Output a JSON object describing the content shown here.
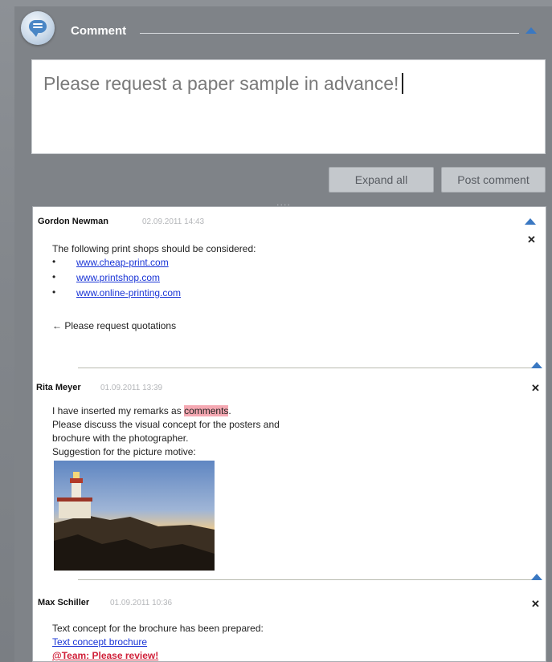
{
  "header": {
    "title": "Comment",
    "icon": "chat-bubble-icon"
  },
  "composer": {
    "value": "Please request a paper sample in advance!"
  },
  "buttons": {
    "expand_all": "Expand all",
    "post_comment": "Post comment"
  },
  "comments": [
    {
      "author": "Gordon Newman",
      "date": "02.09.2011 14:43",
      "intro": "The following print shops should be considered:",
      "links": [
        "www.cheap-print.com",
        "www.printshop.com",
        "www.online-printing.com"
      ],
      "note": "← Please request quotations"
    },
    {
      "author": "Rita Meyer",
      "date": "01.09.2011 13:39",
      "line1_prefix": "I have inserted my remarks as ",
      "line1_highlight": "comments",
      "line1_suffix": ".",
      "line2": "Please discuss the visual concept for the  posters and",
      "line3": "brochure with the photographer.",
      "line4": "Suggestion for the picture motive:"
    },
    {
      "author": "Max Schiller",
      "date": "01.09.2011 10:36",
      "line1": "Text concept for the brochure has been prepared:",
      "link": "Text concept brochure",
      "mention": "@Team: Please review!"
    }
  ],
  "colors": {
    "accent": "#3a78c2",
    "link": "#1a35d6",
    "highlight": "#f5a8b2",
    "alert": "#d0213a"
  }
}
